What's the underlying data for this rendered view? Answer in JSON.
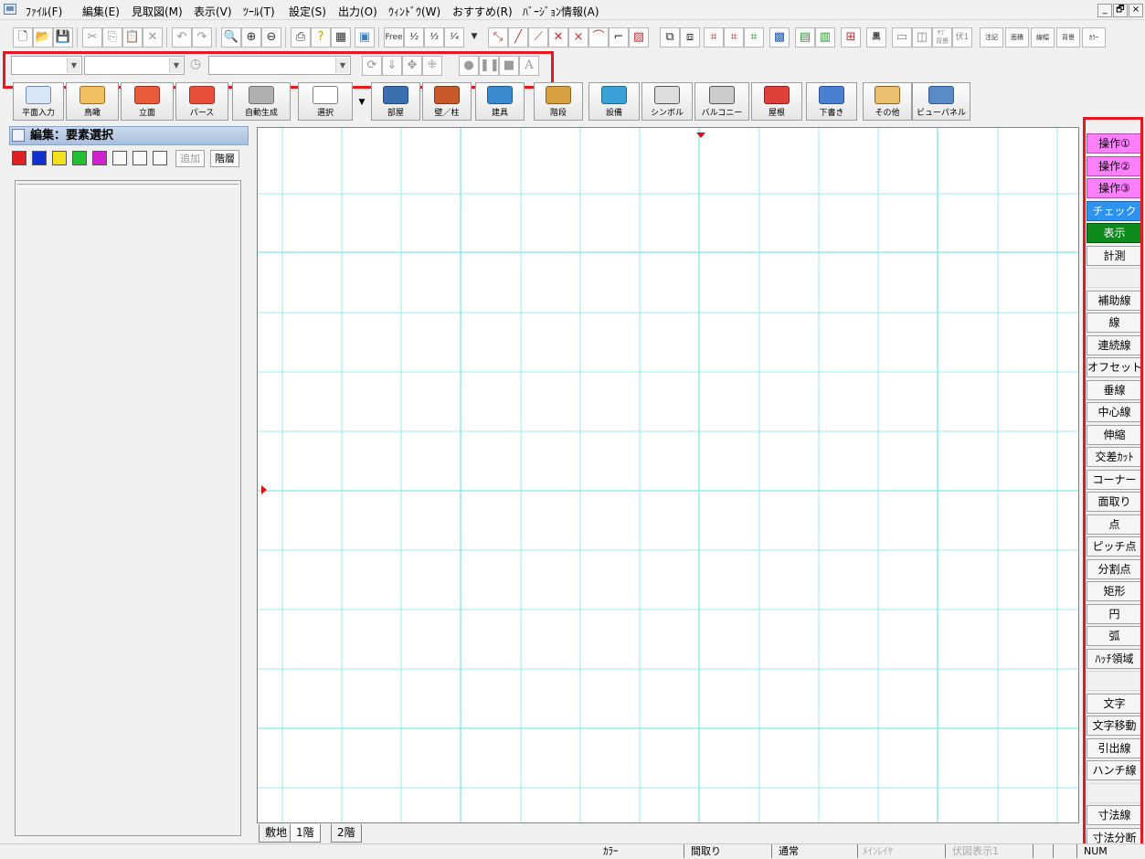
{
  "menu": [
    "ﾌｧｲﾙ(F)",
    "編集(E)",
    "見取図(M)",
    "表示(V)",
    "ﾂｰﾙ(T)",
    "設定(S)",
    "出力(O)",
    "ｳｨﾝﾄﾞｳ(W)",
    "おすすめ(R)",
    "ﾊﾞｰｼﾞｮﾝ情報(A)"
  ],
  "window_controls": [
    "_",
    "🗗",
    "×"
  ],
  "toolbar": {
    "free": "Free",
    "half": "½",
    "third": "⅓",
    "quarter": "¼",
    "sub_label_top": "ｻﾌﾞ",
    "sub_label_bottom": "背景",
    "fuku_label": "伏1",
    "kuroshi": "黒",
    "r1": "注記",
    "r2": "面積",
    "r3": "線幅",
    "r4": "背景",
    "r5": "ｶﾗｰ",
    "text_tool": "A"
  },
  "big_buttons": [
    "平面入力",
    "鳥瞰",
    "立面",
    "パース",
    "自動生成",
    "選択",
    "部屋",
    "壁／柱",
    "建具",
    "階段",
    "設備",
    "シンボル",
    "バルコニー",
    "屋根",
    "下書き",
    "その他",
    "ビューパネル"
  ],
  "left_panel": {
    "title": "編集：要素選択",
    "add_btn": "追加",
    "layer_btn": "階層"
  },
  "sheet_tabs": [
    "敷地",
    "1階",
    "2階"
  ],
  "right_panel": [
    "操作①",
    "操作②",
    "操作③",
    "チェック",
    "表示",
    "計測",
    "",
    "補助線",
    "線",
    "連続線",
    "オフセット",
    "垂線",
    "中心線",
    "伸縮",
    "交差ｶｯﾄ",
    "コーナー",
    "面取り",
    "点",
    "ピッチ点",
    "分割点",
    "矩形",
    "円",
    "弧",
    "ﾊｯﾁ領域",
    "",
    "文字",
    "文字移動",
    "引出線",
    "ハンチ線",
    "",
    "寸法線",
    "寸法分断"
  ],
  "status": {
    "color": "ｶﾗｰ",
    "mode": "間取り",
    "normal": "通常",
    "main_layer": "ﾒｲﾝﾚｲﾔ",
    "fuku": "伏図表示1",
    "num": "NUM"
  },
  "colors": {
    "highlight": "#e8161e",
    "grid": "#7de6ee",
    "pink": "#ff80ff",
    "blue": "#2d93f0",
    "green": "#0c8a1b"
  }
}
